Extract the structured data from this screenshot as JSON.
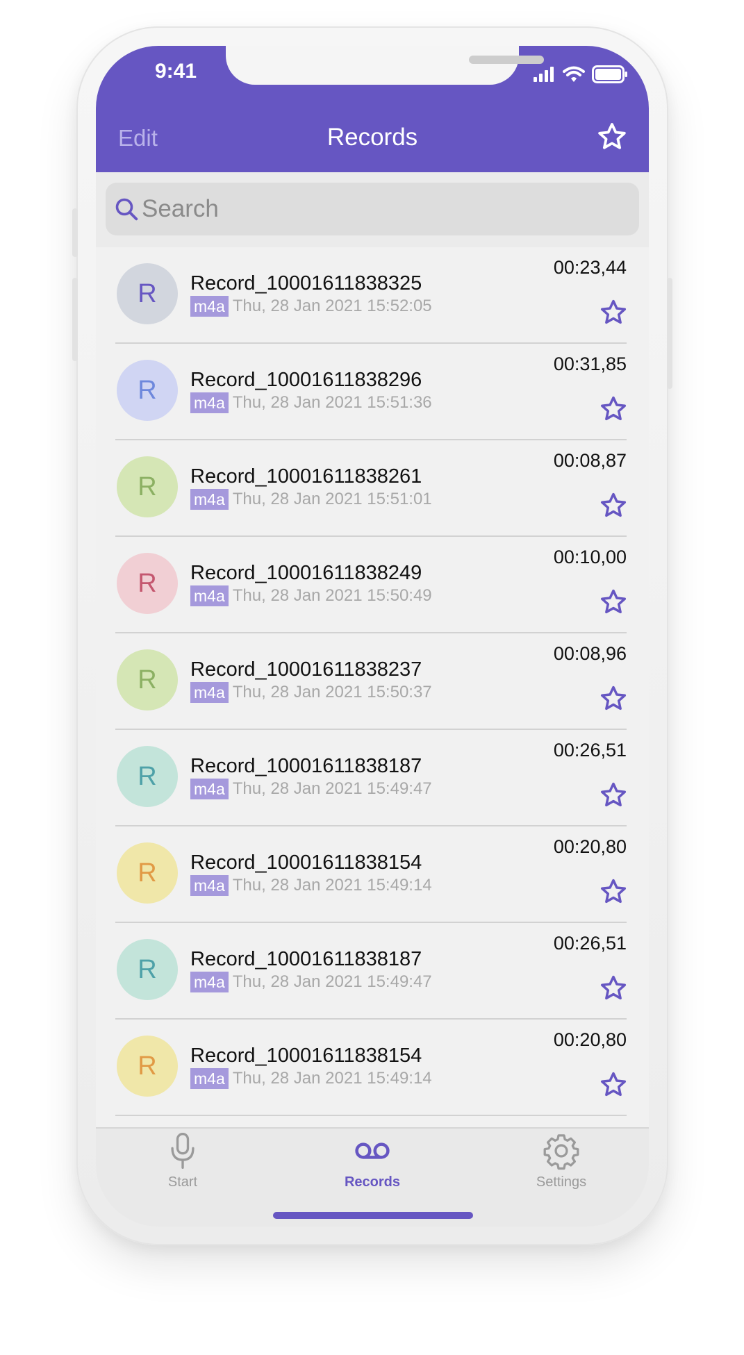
{
  "status_bar": {
    "time": "9:41"
  },
  "header": {
    "edit_label": "Edit",
    "title": "Records",
    "accent_color": "#6656c2"
  },
  "search": {
    "placeholder": "Search"
  },
  "records": [
    {
      "initial": "R",
      "name": "Record_10001611838325",
      "format": "m4a",
      "date": "Thu, 28 Jan 2021 15:52:05",
      "duration": "00:23,44",
      "avatar_bg": "#d2d6de",
      "avatar_fg": "#6656c2"
    },
    {
      "initial": "R",
      "name": "Record_10001611838296",
      "format": "m4a",
      "date": "Thu, 28 Jan 2021 15:51:36",
      "duration": "00:31,85",
      "avatar_bg": "#d0d5f3",
      "avatar_fg": "#6e88dc"
    },
    {
      "initial": "R",
      "name": "Record_10001611838261",
      "format": "m4a",
      "date": "Thu, 28 Jan 2021 15:51:01",
      "duration": "00:08,87",
      "avatar_bg": "#d5e6b5",
      "avatar_fg": "#8cb063"
    },
    {
      "initial": "R",
      "name": "Record_10001611838249",
      "format": "m4a",
      "date": "Thu, 28 Jan 2021 15:50:49",
      "duration": "00:10,00",
      "avatar_bg": "#f1cfd4",
      "avatar_fg": "#c4576f"
    },
    {
      "initial": "R",
      "name": "Record_10001611838237",
      "format": "m4a",
      "date": "Thu, 28 Jan 2021 15:50:37",
      "duration": "00:08,96",
      "avatar_bg": "#d5e6b5",
      "avatar_fg": "#8cb063"
    },
    {
      "initial": "R",
      "name": "Record_10001611838187",
      "format": "m4a",
      "date": "Thu, 28 Jan 2021 15:49:47",
      "duration": "00:26,51",
      "avatar_bg": "#c3e4da",
      "avatar_fg": "#4ea1a8"
    },
    {
      "initial": "R",
      "name": "Record_10001611838154",
      "format": "m4a",
      "date": "Thu, 28 Jan 2021 15:49:14",
      "duration": "00:20,80",
      "avatar_bg": "#f0e7a9",
      "avatar_fg": "#e19a45"
    },
    {
      "initial": "R",
      "name": "Record_10001611838187",
      "format": "m4a",
      "date": "Thu, 28 Jan 2021 15:49:47",
      "duration": "00:26,51",
      "avatar_bg": "#c3e4da",
      "avatar_fg": "#4ea1a8"
    },
    {
      "initial": "R",
      "name": "Record_10001611838154",
      "format": "m4a",
      "date": "Thu, 28 Jan 2021 15:49:14",
      "duration": "00:20,80",
      "avatar_bg": "#f0e7a9",
      "avatar_fg": "#e19a45"
    }
  ],
  "tabs": [
    {
      "label": "Start",
      "icon": "microphone-icon",
      "active": false
    },
    {
      "label": "Records",
      "icon": "voicemail-icon",
      "active": true
    },
    {
      "label": "Settings",
      "icon": "gear-icon",
      "active": false
    }
  ],
  "colors": {
    "accent": "#6656c2",
    "tab_inactive": "#9a9a9a",
    "badge": "#a599dc"
  }
}
